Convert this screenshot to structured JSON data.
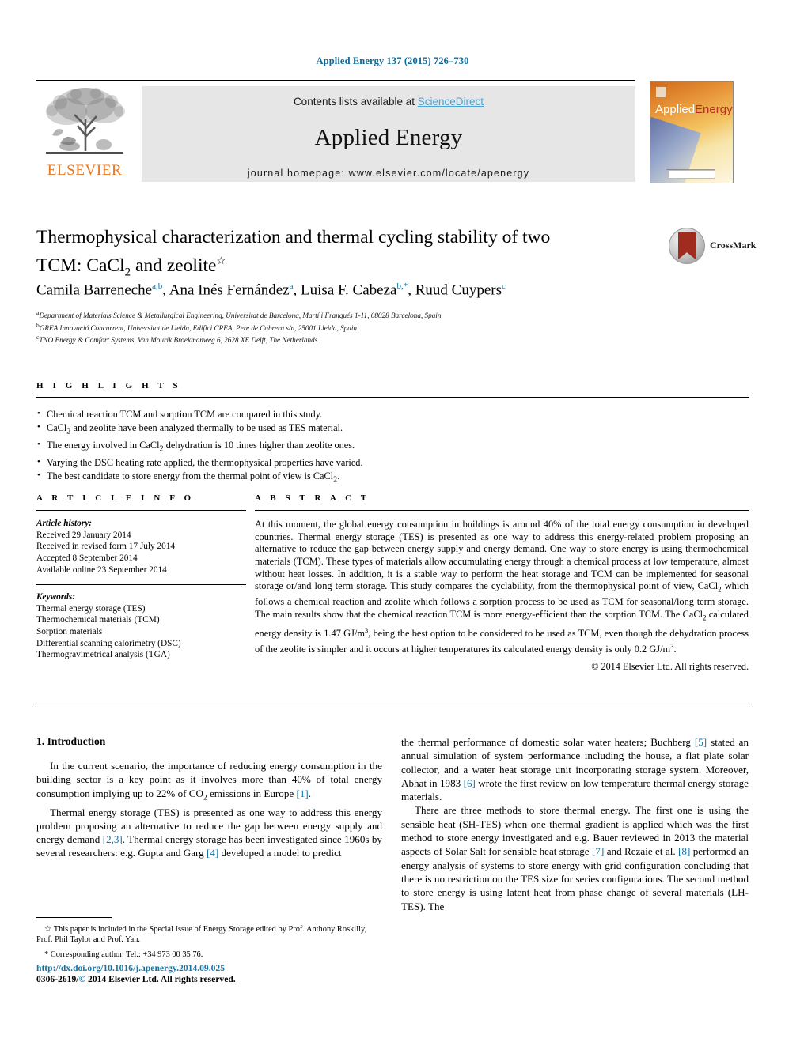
{
  "running_head": "Applied Energy 137 (2015) 726–730",
  "masthead": {
    "publisher": "ELSEVIER",
    "contents_prefix": "Contents lists available at ",
    "contents_link": "ScienceDirect",
    "journal_name": "Applied Energy",
    "homepage": "journal homepage: www.elsevier.com/locate/apenergy",
    "cover_title_1": "Applied",
    "cover_title_2": "Energy"
  },
  "article": {
    "title_line1": "Thermophysical characterization and thermal cycling stability of two",
    "title_line2_a": "TCM: CaCl",
    "title_line2_sub": "2",
    "title_line2_b": " and zeolite",
    "title_star": "☆",
    "crossmark_label": "CrossMark",
    "authors": [
      {
        "name": "Camila Barreneche",
        "marks": "a,b"
      },
      {
        "name": "Ana Inés Fernández",
        "marks": "a"
      },
      {
        "name": "Luisa F. Cabeza",
        "marks": "b,*"
      },
      {
        "name": "Ruud Cuypers",
        "marks": "c"
      }
    ],
    "affiliations": [
      {
        "mark": "a",
        "text": "Department of Materials Science & Metallurgical Engineering, Universitat de Barcelona, Martí i Franqués 1-11, 08028 Barcelona, Spain"
      },
      {
        "mark": "b",
        "text": "GREA Innovació Concurrent, Universitat de Lleida, Edifici CREA, Pere de Cabrera s/n, 25001 Lleida, Spain"
      },
      {
        "mark": "c",
        "text": "TNO Energy & Comfort Systems, Van Mourik Broekmanweg 6, 2628 XE Delft, The Netherlands"
      }
    ]
  },
  "highlights": {
    "label": "H I G H L I G H T S",
    "items": [
      "Chemical reaction TCM and sorption TCM are compared in this study.",
      "CaCl2 and zeolite have been analyzed thermally to be used as TES material.",
      "The energy involved in CaCl2 dehydration is 10 times higher than zeolite ones.",
      "Varying the DSC heating rate applied, the thermophysical properties have varied.",
      "The best candidate to store energy from the thermal point of view is CaCl2."
    ]
  },
  "article_info": {
    "label": "A R T I C L E    I N F O",
    "history_title": "Article history:",
    "history": [
      "Received 29 January 2014",
      "Received in revised form 17 July 2014",
      "Accepted 8 September 2014",
      "Available online 23 September 2014"
    ],
    "keywords_title": "Keywords:",
    "keywords": [
      "Thermal energy storage (TES)",
      "Thermochemical materials (TCM)",
      "Sorption materials",
      "Differential scanning calorimetry (DSC)",
      "Thermogravimetrical analysis (TGA)"
    ]
  },
  "abstract": {
    "label": "A B S T R A C T",
    "text": "At this moment, the global energy consumption in buildings is around 40% of the total energy consumption in developed countries. Thermal energy storage (TES) is presented as one way to address this energy-related problem proposing an alternative to reduce the gap between energy supply and energy demand. One way to store energy is using thermochemical materials (TCM). These types of materials allow accumulating energy through a chemical process at low temperature, almost without heat losses. In addition, it is a stable way to perform the heat storage and TCM can be implemented for seasonal storage or/and long term storage. This study compares the cyclability, from the thermophysical point of view, CaCl2 which follows a chemical reaction and zeolite which follows a sorption process to be used as TCM for seasonal/long term storage. The main results show that the chemical reaction TCM is more energy-efficient than the sorption TCM. The CaCl2 calculated energy density is 1.47 GJ/m3, being the best option to be considered to be used as TCM, even though the dehydration process of the zeolite is simpler and it occurs at higher temperatures its calculated energy density is only 0.2 GJ/m3.",
    "copyright": "© 2014 Elsevier Ltd. All rights reserved."
  },
  "body": {
    "section_title": "1. Introduction",
    "left_p1": "In the current scenario, the importance of reducing energy consumption in the building sector is a key point as it involves more than 40% of total energy consumption implying up to 22% of CO2 emissions in Europe [1].",
    "left_p2": "Thermal energy storage (TES) is presented as one way to address this energy problem proposing an alternative to reduce the gap between energy supply and energy demand [2,3]. Thermal energy storage has been investigated since 1960s by several researchers: e.g. Gupta and Garg [4] developed a model to predict",
    "right_p1": "the thermal performance of domestic solar water heaters; Buchberg [5] stated an annual simulation of system performance including the house, a flat plate solar collector, and a water heat storage unit incorporating storage system. Moreover, Abhat in 1983 [6] wrote the first review on low temperature thermal energy storage materials.",
    "right_p2": "There are three methods to store thermal energy. The first one is using the sensible heat (SH-TES) when one thermal gradient is applied which was the first method to store energy investigated and e.g. Bauer reviewed in 2013 the material aspects of Solar Salt for sensible heat storage [7] and Rezaie et al. [8] performed an energy analysis of systems to store energy with grid configuration concluding that there is no restriction on the TES size for series configurations. The second method to store energy is using latent heat from phase change of several materials (LH-TES). The"
  },
  "footnotes": {
    "star_note": "☆ This paper is included in the Special Issue of Energy Storage edited by Prof. Anthony Roskilly, Prof. Phil Taylor and Prof. Yan.",
    "corresponding_note": "* Corresponding author. Tel.: +34 973 00 35 76."
  },
  "footer": {
    "doi": "http://dx.doi.org/10.1016/j.apenergy.2014.09.025",
    "issn_prefix": "0306-2619/",
    "issn_symbol": "©",
    "issn_suffix": " 2014 Elsevier Ltd. All rights reserved."
  },
  "colors": {
    "link": "#1273a8",
    "running_head": "#0b6a9a",
    "elsevier_orange": "#e87722",
    "sciencedirect": "#4ba3d3"
  }
}
